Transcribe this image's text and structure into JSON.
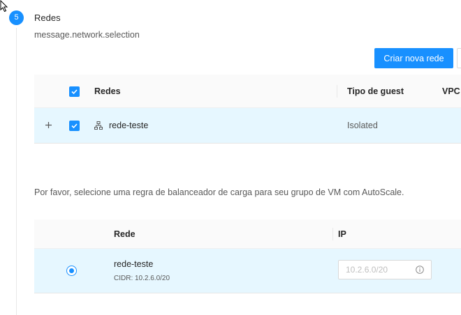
{
  "step": {
    "number": "5",
    "title": "Redes",
    "description": "message.network.selection"
  },
  "actions": {
    "create_network_label": "Criar nova rede"
  },
  "network_table": {
    "columns": [
      "Redes",
      "Tipo de guest",
      "VPC"
    ],
    "rows": [
      {
        "name": "rede-teste",
        "guest_type": "Isolated",
        "selected": true
      }
    ]
  },
  "lb_prompt": "Por favor, selecione uma regra de balanceador de carga para seu grupo de VM com AutoScale.",
  "lb_table": {
    "columns": [
      "Rede",
      "IP"
    ],
    "rows": [
      {
        "network": "rede-teste",
        "cidr": "CIDR: 10.2.6.0/20",
        "ip_placeholder": "10.2.6.0/20",
        "selected": true
      }
    ]
  },
  "colors": {
    "primary": "#1890ff",
    "row_selected_bg": "#e6f7ff",
    "header_bg": "#fafafa"
  }
}
